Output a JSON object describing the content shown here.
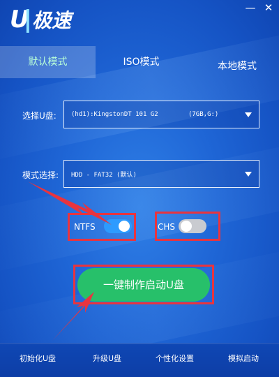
{
  "header": {
    "logo_letter": "U",
    "logo_text": "极速",
    "minimize_glyph": "—",
    "close_glyph": "✕"
  },
  "tabs": [
    {
      "label": "默认模式",
      "active": true
    },
    {
      "label": "ISO模式",
      "active": false
    },
    {
      "label": "本地模式",
      "active": false
    }
  ],
  "form": {
    "usb_label": "选择U盘:",
    "usb_value": "(hd1):KingstonDT 101 G2        (7GB,G:)",
    "mode_label": "模式选择:",
    "mode_value": "HDD - FAT32 (默认)"
  },
  "options": {
    "ntfs_label": "NTFS",
    "ntfs_on": true,
    "chs_label": "CHS",
    "chs_on": false
  },
  "primary_button": "一键制作启动U盘",
  "bottom_bar": [
    {
      "label": "初始化U盘"
    },
    {
      "label": "升级U盘"
    },
    {
      "label": "个性化设置"
    },
    {
      "label": "模拟启动"
    }
  ],
  "colors": {
    "accent_green": "#27c06a",
    "annotation_red": "#e8343f",
    "toggle_on": "#2d9bff"
  }
}
